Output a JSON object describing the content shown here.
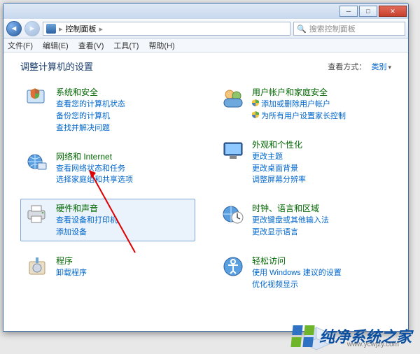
{
  "titlebar": {
    "min_glyph": "─",
    "max_glyph": "□",
    "close_glyph": "✕"
  },
  "addressbar": {
    "nav_back_glyph": "◄",
    "nav_fwd_glyph": "►",
    "crumb_root": "控制面板",
    "crumb_sep": "▸",
    "search_placeholder": "搜索控制面板",
    "search_icon": "🔍"
  },
  "menubar": {
    "items": [
      "文件(F)",
      "编辑(E)",
      "查看(V)",
      "工具(T)",
      "帮助(H)"
    ]
  },
  "heading": "调整计算机的设置",
  "view_by": {
    "label": "查看方式：",
    "value": "类别",
    "caret": "▾"
  },
  "left_col": [
    {
      "id": "system-security",
      "icon": "shield",
      "title": "系统和安全",
      "links": [
        "查看您的计算机状态",
        "备份您的计算机",
        "查找并解决问题"
      ]
    },
    {
      "id": "network-internet",
      "icon": "globe-net",
      "title": "网络和 Internet",
      "links": [
        "查看网络状态和任务",
        "选择家庭组和共享选项"
      ]
    },
    {
      "id": "hardware-sound",
      "icon": "printer",
      "highlight": true,
      "title": "硬件和声音",
      "links": [
        "查看设备和打印机",
        "添加设备"
      ]
    },
    {
      "id": "programs",
      "icon": "box",
      "title": "程序",
      "links": [
        "卸载程序"
      ]
    }
  ],
  "right_col": [
    {
      "id": "user-accounts",
      "icon": "users",
      "title": "用户帐户和家庭安全",
      "links": [
        "添加或删除用户帐户",
        "为所有用户设置家长控制"
      ],
      "link_icons": [
        "shield-small",
        "shield-small"
      ]
    },
    {
      "id": "appearance",
      "icon": "monitor",
      "title": "外观和个性化",
      "links": [
        "更改主题",
        "更改桌面背景",
        "调整屏幕分辨率"
      ]
    },
    {
      "id": "clock-region",
      "icon": "clock-globe",
      "title": "时钟、语言和区域",
      "links": [
        "更改键盘或其他输入法",
        "更改显示语言"
      ]
    },
    {
      "id": "ease-access",
      "icon": "ease",
      "title": "轻松访问",
      "links": [
        "使用 Windows 建议的设置",
        "优化视频显示"
      ]
    }
  ],
  "watermark": {
    "text": "纯净系统之家",
    "url": "www.ycwjzy.com"
  }
}
